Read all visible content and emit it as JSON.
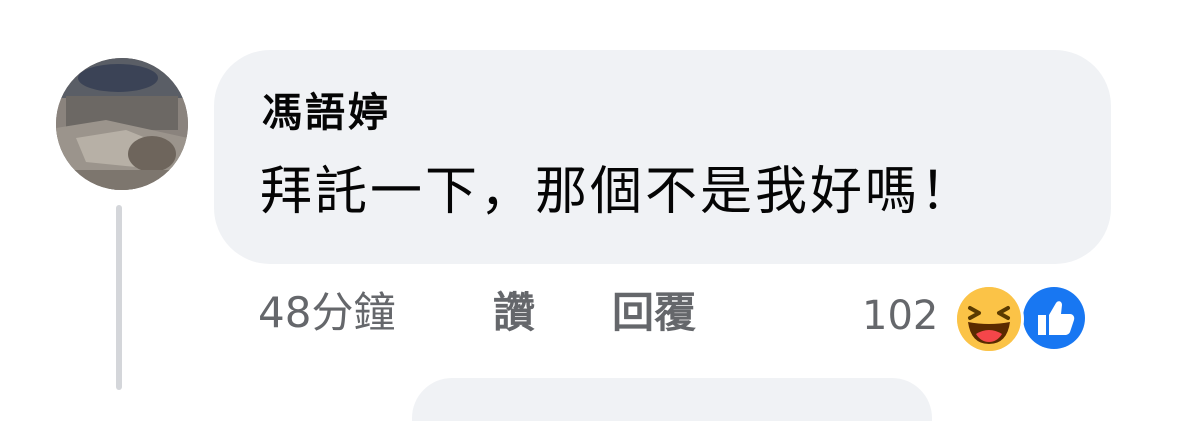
{
  "comment": {
    "author": "馮語婷",
    "text": "拜託一下，那個不是我好嗎！",
    "timestamp": "48分鐘",
    "like_label": "讚",
    "reply_label": "回覆",
    "reaction_count": "102",
    "reactions": [
      {
        "icon": "haha-reaction-icon",
        "color": "#f7b125"
      },
      {
        "icon": "like-reaction-icon",
        "color": "#1877f2"
      }
    ]
  },
  "colors": {
    "bubble": "#f0f2f5",
    "text": "#050505",
    "meta": "#65676b",
    "like_blue": "#1877f2",
    "haha_yellow": "#f7b125"
  }
}
